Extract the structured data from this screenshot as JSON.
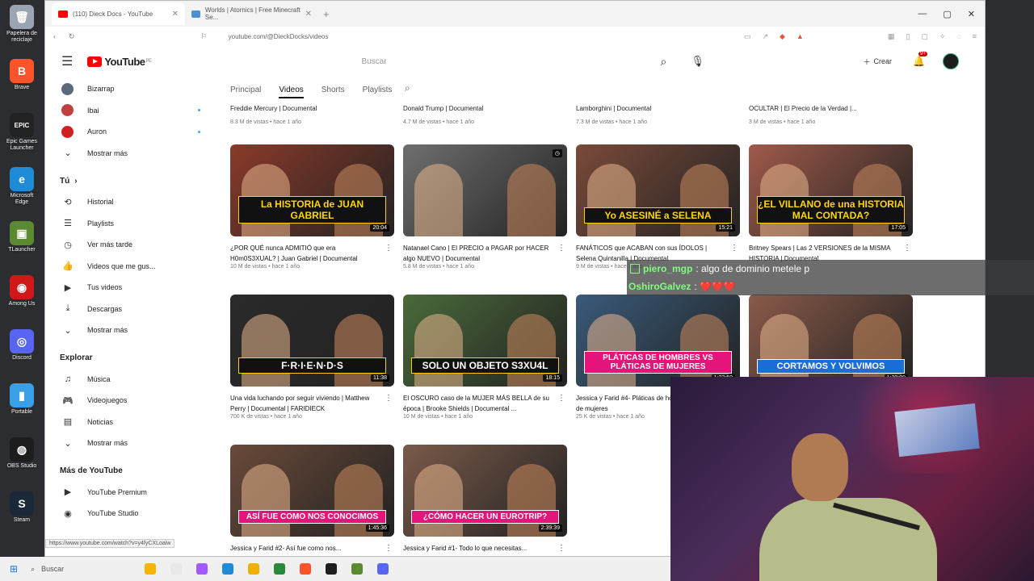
{
  "desktop": {
    "icons": [
      {
        "label": "Papelera de reciclaje",
        "color": "#9aa5b1",
        "glyph": "🗑"
      },
      {
        "label": "Brave",
        "color": "#fb542b",
        "glyph": "B"
      },
      {
        "label": "Epic Games Launcher",
        "color": "#222222",
        "glyph": "EPIC"
      },
      {
        "label": "Microsoft Edge",
        "color": "#1f8ad6",
        "glyph": "e"
      },
      {
        "label": "TLauncher",
        "color": "#5b8a32",
        "glyph": "▣"
      },
      {
        "label": "Among Us",
        "color": "#d01818",
        "glyph": "◉"
      },
      {
        "label": "Discord",
        "color": "#5865f2",
        "glyph": "◎"
      },
      {
        "label": "Portable",
        "color": "#39a0e8",
        "glyph": "▮"
      },
      {
        "label": "OBS Studio",
        "color": "#1d1d1d",
        "glyph": "◍"
      },
      {
        "label": "Steam",
        "color": "#1b2838",
        "glyph": "S"
      }
    ]
  },
  "browser": {
    "tabs": [
      {
        "title": "(110) Dieck Docs - YouTube",
        "fav_color": "#ff0000",
        "active": true
      },
      {
        "title": "Worlds | Atornics | Free Minecraft Se...",
        "fav_color": "#4a90d9",
        "active": false
      }
    ],
    "new_tab": "+",
    "window_controls": [
      "—",
      "▢",
      "✕"
    ],
    "url": "youtube.com/@DieckDocks/videos",
    "status_url": "https://www.youtube.com/watch?v=y4fyCXLoaiw"
  },
  "youtube": {
    "logo_text": "YouTube",
    "logo_sup": "PE",
    "search_placeholder": "Buscar",
    "create_label": "Crear",
    "notif_count": "9+",
    "sidebar": {
      "subs": [
        {
          "label": "Bizarrap",
          "color": "#5a6a7a",
          "live": false
        },
        {
          "label": "Ibai",
          "color": "#c04040",
          "live": true
        },
        {
          "label": "Auron",
          "color": "#d02020",
          "live": true
        }
      ],
      "show_more": "Mostrar más",
      "you_header": "Tú",
      "you_items": [
        {
          "label": "Historial",
          "icon": "⟲"
        },
        {
          "label": "Playlists",
          "icon": "☰"
        },
        {
          "label": "Ver más tarde",
          "icon": "◷"
        },
        {
          "label": "Videos que me gus...",
          "icon": "👍"
        },
        {
          "label": "Tus videos",
          "icon": "▶"
        },
        {
          "label": "Descargas",
          "icon": "⤓"
        },
        {
          "label": "Mostrar más",
          "icon": "⌄"
        }
      ],
      "explore_header": "Explorar",
      "explore_items": [
        {
          "label": "Música",
          "icon": "♫"
        },
        {
          "label": "Videojuegos",
          "icon": "🎮"
        },
        {
          "label": "Noticias",
          "icon": "▤"
        },
        {
          "label": "Mostrar más",
          "icon": "⌄"
        }
      ],
      "more_header": "Más de YouTube",
      "more_items": [
        {
          "label": "YouTube Premium",
          "icon": "▶"
        },
        {
          "label": "YouTube Studio",
          "icon": "◉"
        }
      ]
    },
    "channel_tabs": [
      "Principal",
      "Videos",
      "Shorts",
      "Playlists"
    ],
    "active_tab": "Videos",
    "partial_row": [
      {
        "title": "Freddie Mercury | Documental",
        "meta": "8.3 M de vistas • hace 1 año"
      },
      {
        "title": "Donald Trump | Documental",
        "meta": "4.7 M de vistas • hace 1 año"
      },
      {
        "title": "Lamborghini | Documental",
        "meta": "7.3 M de vistas • hace 1 año"
      },
      {
        "title": "OCULTAR | El Precio de la Verdad |...",
        "meta": "3 M de vistas • hace 1 año"
      }
    ],
    "videos": [
      {
        "title": "¿POR QUÉ nunca ADMITIÓ que era H0m0S3XUAL? | Juan Gabriel | Documental",
        "meta": "10 M de vistas • hace 1 año",
        "duration": "20:04",
        "caption": "La HISTORIA de JUAN GABRIEL",
        "bg": "#8a3a2a",
        "cap_style": "yellow"
      },
      {
        "title": "Natanael Cano | El PRECIO a PAGAR por HACER algo NUEVO | Documental",
        "meta": "5.8 M de vistas • hace 1 año",
        "duration": "",
        "caption": "",
        "bg": "#6f6f6f",
        "cap_style": ""
      },
      {
        "title": "FANÁTICOS que ACABAN con sus ÍDOLOS | Selena Quintanilla | Documental",
        "meta": "9 M de vistas • hace 1 año",
        "duration": "15:21",
        "caption": "Yo ASESINÉ a SELENA",
        "bg": "#7a4a3a",
        "cap_style": "yellow"
      },
      {
        "title": "Britney Spears | Las 2 VERSIONES de la MISMA HISTORIA | Documental",
        "meta": "",
        "duration": "17:05",
        "caption": "¿EL VILLANO de una HISTORIA MAL CONTADA?",
        "bg": "#a05a4a",
        "cap_style": "yellow"
      },
      {
        "title": "Una vida luchando por seguir viviendo | Matthew Perry | Documental | FARIDIECK",
        "meta": "700 K de vistas • hace 1 año",
        "duration": "11:38",
        "caption": "F·R·I·E·N·D·S",
        "bg": "#2a2a2a",
        "cap_style": ""
      },
      {
        "title": "El OSCURO caso de la MUJER MÁS BELLA de su época | Brooke Shields | Documental ...",
        "meta": "10 M de vistas • hace 1 año",
        "duration": "18:15",
        "caption": "SOLO UN OBJETO S3XU4L",
        "bg": "#4a6a3a",
        "cap_style": ""
      },
      {
        "title": "Jessica y Farid #4- Pláticas de hombres vs pláticas de mujeres",
        "meta": "25 K de vistas • hace 1 año",
        "duration": "1:23:59",
        "caption": "PLÁTICAS DE HOMBRES VS PLÁTICAS DE MUJERES",
        "bg": "#3a5a7a",
        "cap_style": "pink"
      },
      {
        "title": "",
        "meta": "",
        "duration": "1:30:09",
        "caption": "CORTAMOS Y VOLVIMOS",
        "bg": "#8a5a4a",
        "cap_style": "blue"
      },
      {
        "title": "Jessica y Farid #2- Así fue como nos...",
        "meta": "",
        "duration": "1:45:36",
        "caption": "ASÍ FUE COMO NOS CONOCIMOS",
        "bg": "#6a4a3a",
        "cap_style": "pink"
      },
      {
        "title": "Jessica y Farid #1- Todo lo que necesitas...",
        "meta": "",
        "duration": "2:39:39",
        "caption": "¿CÓMO HACER UN EUROTRIP?",
        "bg": "#7a5a4a",
        "cap_style": "pink"
      }
    ]
  },
  "chat": [
    {
      "user": "piero_mgp",
      "message": ": algo de dominio metele p"
    },
    {
      "user": "OshiroGalvez",
      "message": ": ❤️❤️❤️"
    }
  ],
  "taskbar": {
    "search_label": "Buscar",
    "apps": [
      "#f5b400",
      "#e8e8e8",
      "#a259ff",
      "#1f8ad6",
      "#f0b000",
      "#2a8a3a",
      "#fb542b",
      "#1d1d1d",
      "#5b8a32",
      "#5865f2"
    ]
  }
}
